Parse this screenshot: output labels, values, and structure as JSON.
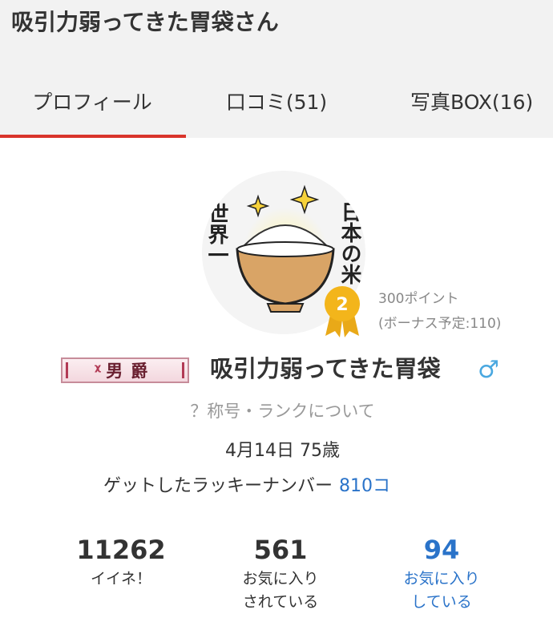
{
  "page_title": "吸引力弱ってきた胃袋さん",
  "tabs": [
    {
      "label": "プロフィール",
      "active": true
    },
    {
      "label": "口コミ(51)",
      "active": false
    },
    {
      "label": "写真BOX(16)",
      "active": false
    }
  ],
  "colors": {
    "tab_accent": "#d9342b",
    "link_blue": "#2a73c9",
    "gender_blue": "#4aa8e0",
    "rank_gold": "#f3b51b"
  },
  "avatar": {
    "text_right": "日本の米",
    "text_left": "世界一",
    "icons": [
      "rice-bowl-icon",
      "sparkle-icon"
    ]
  },
  "rank": {
    "number": "2",
    "points": "300ポイント",
    "bonus": "(ボーナス予定:110)"
  },
  "title_badge": {
    "text": "男爵",
    "mark": "ᵡ"
  },
  "username": "吸引力弱ってきた胃袋",
  "gender_symbol": "♂",
  "rank_link": "？称号・ランクについて",
  "birthday": "4月14日 75歳",
  "lucky_number": {
    "label": "ゲットしたラッキーナンバー",
    "value": "810コ"
  },
  "stats": [
    {
      "value": "11262",
      "label": "イイネ！"
    },
    {
      "value": "561",
      "label": "お気に入り\nされている"
    },
    {
      "value": "94",
      "label": "お気に入り\nしている"
    }
  ]
}
